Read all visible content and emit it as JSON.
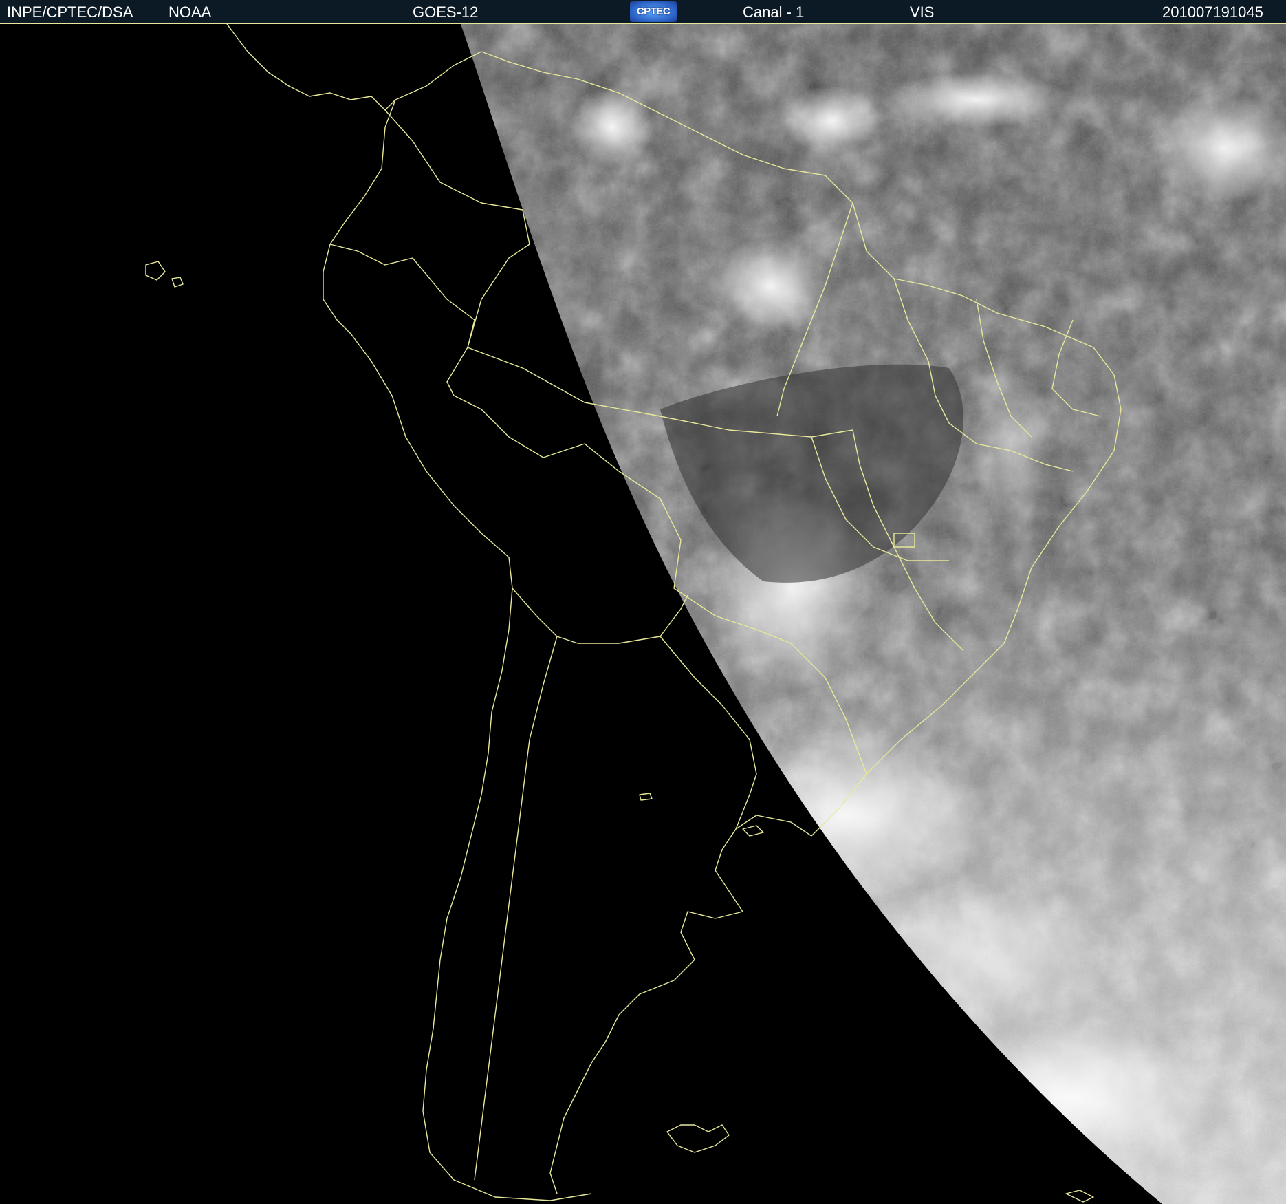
{
  "header": {
    "institution": "INPE/CPTEC/DSA",
    "agency": "NOAA",
    "satellite": "GOES-12",
    "logo_text": "CPTEC",
    "channel": "Canal - 1",
    "band": "VIS",
    "timestamp": "201007191045"
  },
  "colors": {
    "header_background": "#0c1a26",
    "header_text": "#ffffff",
    "outline": "#e8e89a",
    "night_side": "#000000",
    "cloud_bright": "#f2f2f2",
    "surface_dark": "#3e3e3e"
  },
  "icons": {
    "logo": "cptec-logo"
  }
}
